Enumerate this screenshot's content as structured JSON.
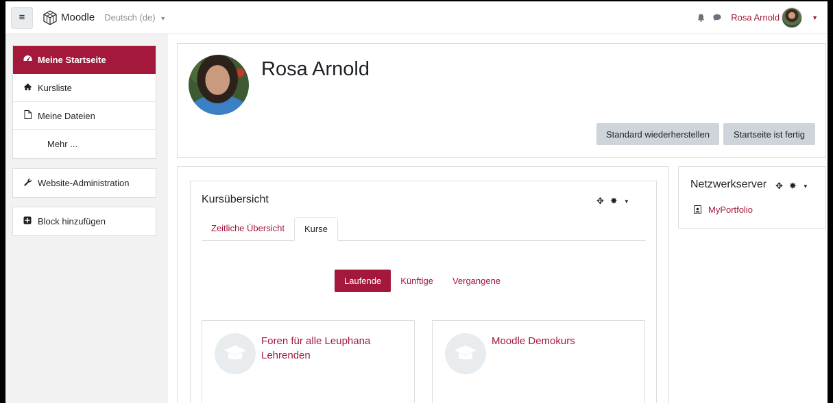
{
  "navbar": {
    "menu_icon": "hamburger-icon",
    "brand": "Moodle",
    "language": "Deutsch (de)",
    "user_name": "Rosa Arnold"
  },
  "sidebar": {
    "nav": [
      {
        "label": "Meine Startseite",
        "icon": "dashboard-icon",
        "active": true
      },
      {
        "label": "Kursliste",
        "icon": "home-icon"
      },
      {
        "label": "Meine Dateien",
        "icon": "file-icon"
      },
      {
        "label": "Mehr ..."
      }
    ],
    "admin": {
      "label": "Website-Administration",
      "icon": "wrench-icon"
    },
    "add_block": {
      "label": "Block hinzufügen",
      "icon": "plus-square-icon"
    }
  },
  "profile": {
    "name": "Rosa Arnold",
    "reset_button": "Standard wiederherstellen",
    "done_button": "Startseite ist fertig"
  },
  "course_overview": {
    "title": "Kursübersicht",
    "tabs": [
      "Zeitliche Übersicht",
      "Kurse"
    ],
    "active_tab": 1,
    "filters": [
      "Laufende",
      "Künftige",
      "Vergangene"
    ],
    "active_filter": 0,
    "courses": [
      {
        "title": "Foren für alle Leuphana Lehrenden"
      },
      {
        "title": "Moodle Demokurs"
      }
    ]
  },
  "network_block": {
    "title": "Netzwerkserver",
    "link": "MyPortfolio"
  },
  "colors": {
    "accent": "#a3183b",
    "button_grey": "#ced4da",
    "drawer_bg": "#f2f2f2"
  }
}
